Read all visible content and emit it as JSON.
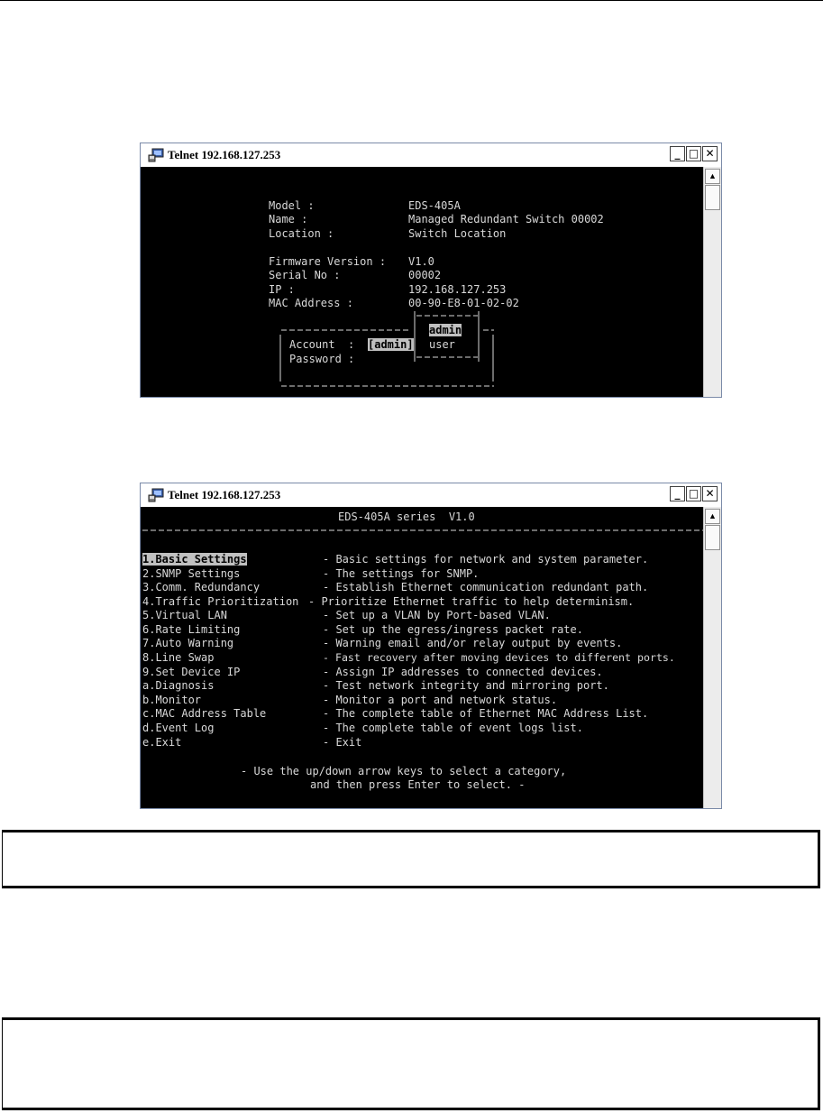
{
  "window_1": {
    "title": "Telnet 192.168.127.253",
    "info": [
      {
        "label": "Model :",
        "value": "EDS-405A"
      },
      {
        "label": "Name :",
        "value": "Managed Redundant Switch 00002"
      },
      {
        "label": "Location :",
        "value": "Switch Location"
      },
      {
        "label": "Firmware Version :",
        "value": "V1.0"
      },
      {
        "label": "Serial No :",
        "value": "00002"
      },
      {
        "label": "IP :",
        "value": "192.168.127.253"
      },
      {
        "label": "MAC Address :",
        "value": "00-90-E8-01-02-02"
      }
    ],
    "login": {
      "account_label": "Account  :",
      "account_value": "[admin]",
      "password_label": "Password :",
      "options": [
        "admin",
        "user"
      ]
    }
  },
  "window_2": {
    "title": "Telnet 192.168.127.253",
    "header": "EDS-405A series  V1.0",
    "menu": [
      {
        "label": "1.Basic Settings",
        "desc": "- Basic settings for network and system parameter."
      },
      {
        "label": "2.SNMP Settings",
        "desc": "- The settings for SNMP."
      },
      {
        "label": "3.Comm. Redundancy",
        "desc": "- Establish Ethernet communication redundant path."
      },
      {
        "label": "4.Traffic Prioritization",
        "desc": "- Prioritize Ethernet traffic to help determinism."
      },
      {
        "label": "5.Virtual LAN",
        "desc": "- Set up a VLAN by Port-based VLAN."
      },
      {
        "label": "6.Rate Limiting",
        "desc": "- Set up the egress/ingress packet rate."
      },
      {
        "label": "7.Auto Warning",
        "desc": "- Warning email and/or relay output by events."
      },
      {
        "label": "8.Line Swap",
        "desc": "- Fast recovery after moving devices to different ports."
      },
      {
        "label": "9.Set Device IP",
        "desc": "- Assign IP addresses to connected devices."
      },
      {
        "label": "a.Diagnosis",
        "desc": "- Test network integrity and mirroring port."
      },
      {
        "label": "b.Monitor",
        "desc": "- Monitor a port and network status."
      },
      {
        "label": "c.MAC Address Table",
        "desc": "- The complete table of Ethernet MAC Address List."
      },
      {
        "label": "d.Event Log",
        "desc": "- The complete table of event logs list."
      },
      {
        "label": "e.Exit",
        "desc": "- Exit"
      }
    ],
    "footer_1": "- Use the up/down arrow keys to select a category,",
    "footer_2": "and then press Enter to select. -"
  }
}
